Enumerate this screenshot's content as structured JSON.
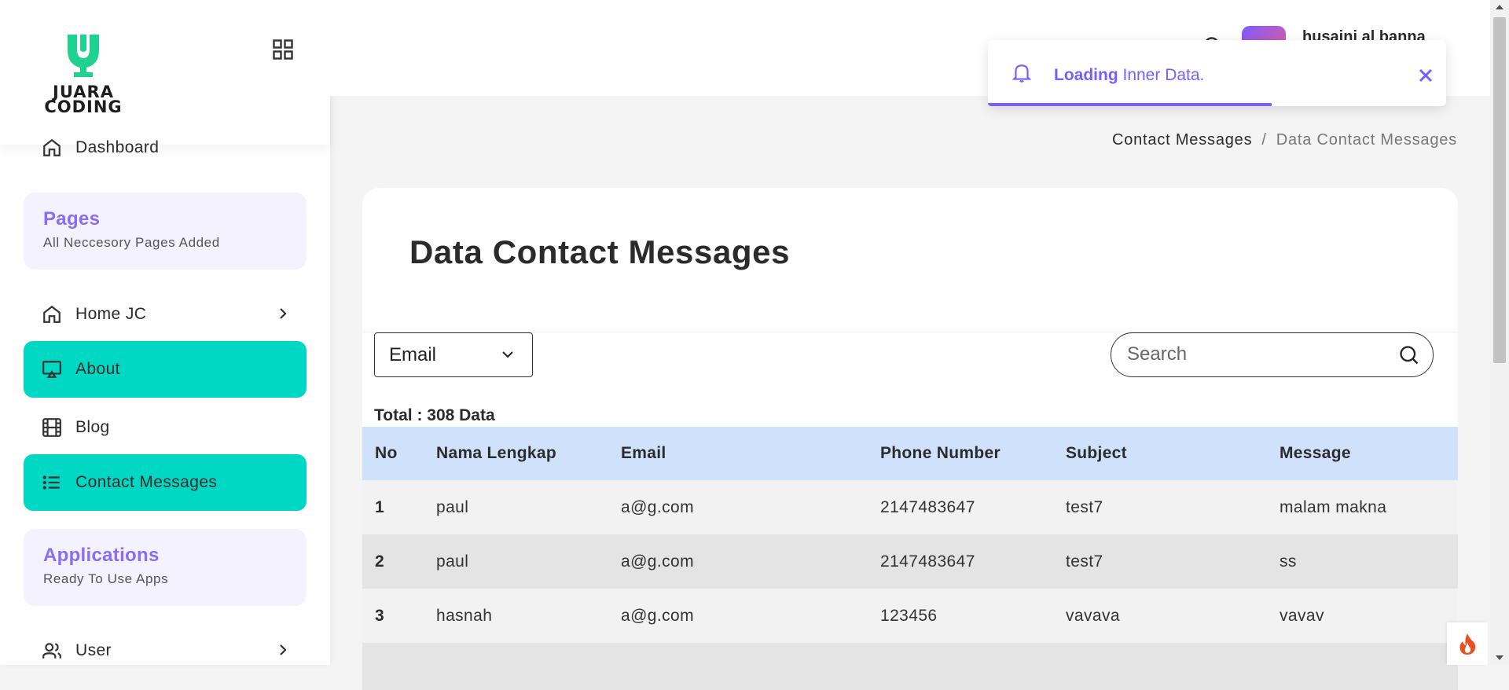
{
  "sidebar": {
    "logo_text_line1": "JUARA",
    "logo_text_line2": "CODING",
    "dashboard": {
      "label": "Dashboard",
      "icon": "home-icon"
    },
    "pages_section": {
      "title": "Pages",
      "subtitle": "All Neccesory Pages Added"
    },
    "items": [
      {
        "label": "Home JC",
        "icon": "home-icon",
        "has_submenu": true
      },
      {
        "label": "About",
        "icon": "airplay-icon",
        "active": true
      },
      {
        "label": "Blog",
        "icon": "film-icon"
      },
      {
        "label": "Contact Messages",
        "icon": "list-icon",
        "active": true
      }
    ],
    "applications_section": {
      "title": "Applications",
      "subtitle": "Ready To Use Apps"
    },
    "user_item": {
      "label": "User",
      "icon": "users-icon",
      "has_submenu": true
    },
    "active_color": "#00d8c4",
    "section_title_color": "#8a6cf5"
  },
  "header": {
    "user_name": "husaini al banna"
  },
  "toast": {
    "bold": "Loading",
    "text": " Inner Data.",
    "progress": 0.62,
    "accent_color": "#7a5cff"
  },
  "breadcrumb": {
    "parent": "Contact Messages",
    "separator": "/",
    "current": "Data Contact Messages"
  },
  "main": {
    "title": "Data Contact Messages",
    "filter": {
      "selected": "Email"
    },
    "search": {
      "placeholder": "Search",
      "value": ""
    },
    "total_label": "Total : 308 Data",
    "table": {
      "header_color": "#cfe1fb",
      "columns": [
        "No",
        "Nama Lengkap",
        "Email",
        "Phone Number",
        "Subject",
        "Message"
      ],
      "rows": [
        {
          "no": "1",
          "nama": "paul",
          "email": "a@g.com",
          "phone": "2147483647",
          "subject": "test7",
          "message": "malam makna"
        },
        {
          "no": "2",
          "nama": "paul",
          "email": "a@g.com",
          "phone": "2147483647",
          "subject": "test7",
          "message": "ss"
        },
        {
          "no": "3",
          "nama": "hasnah",
          "email": "a@g.com",
          "phone": "123456",
          "subject": "vavava",
          "message": "vavav"
        }
      ]
    }
  }
}
